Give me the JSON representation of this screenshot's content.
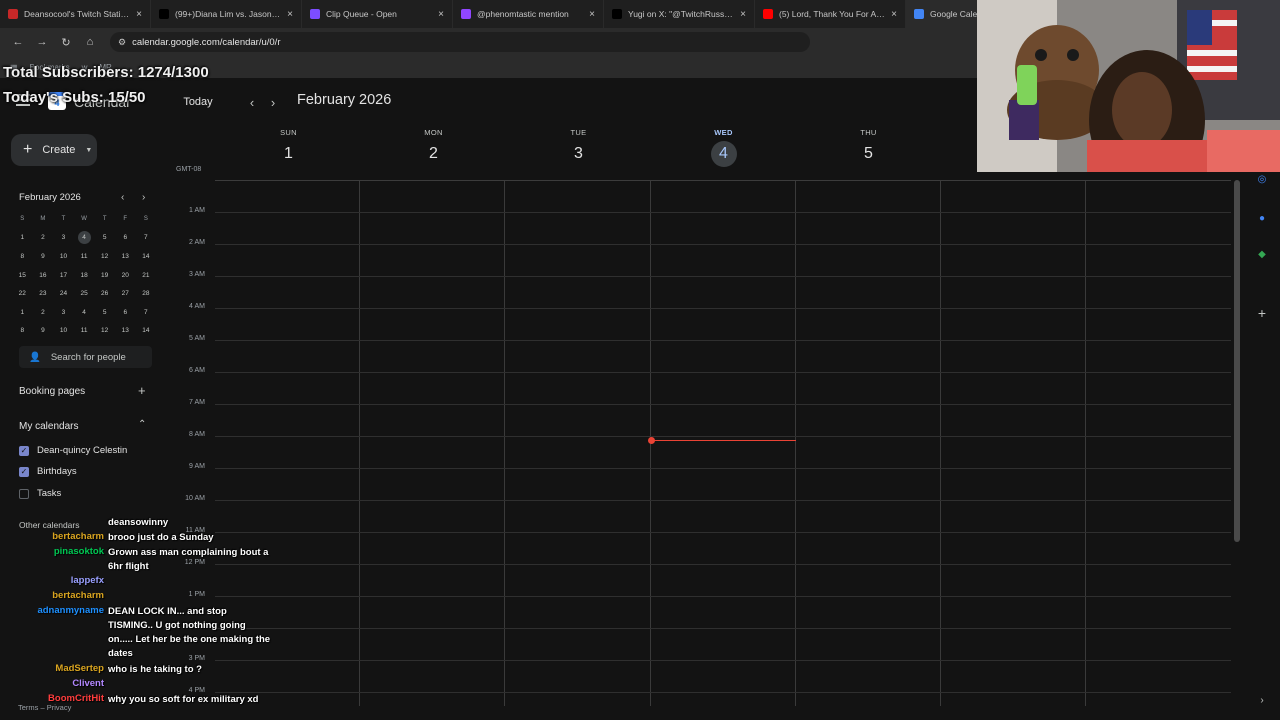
{
  "browser": {
    "tabs": [
      {
        "title": "Deansocool's Twitch Statistics",
        "fav": "chart",
        "color": "#c62828"
      },
      {
        "title": "(99+)Diana Lim vs. Jason the",
        "fav": "tiktok",
        "color": "#000000"
      },
      {
        "title": "Clip Queue - Open",
        "fav": "queue",
        "color": "#7c4dff"
      },
      {
        "title": "@phenomtastic mention",
        "fav": "twitch",
        "color": "#9146ff"
      },
      {
        "title": "Yugi on X: \"@TwitchRussel In",
        "fav": "x",
        "color": "#000000"
      },
      {
        "title": "(5) Lord, Thank You For All Yo",
        "fav": "youtube",
        "color": "#ff0000"
      },
      {
        "title": "Google Calendar",
        "fav": "calendar",
        "color": "#4285f4"
      }
    ],
    "url": "calendar.google.com/calendar/u/0/r",
    "bookmarks": [
      "Bookmarks",
      "w",
      "MR"
    ]
  },
  "overlay": {
    "total_subs": "Total Subscribers: 1274/1300",
    "today_subs": "Today's Subs: 15/50"
  },
  "calendar": {
    "app_name": "Calendar",
    "today_label": "Today",
    "month_title": "February 2026",
    "create_label": "Create",
    "timezone": "GMT-08",
    "days": [
      {
        "dow": "SUN",
        "num": "1"
      },
      {
        "dow": "MON",
        "num": "2"
      },
      {
        "dow": "TUE",
        "num": "3"
      },
      {
        "dow": "WED",
        "num": "4",
        "today": true
      },
      {
        "dow": "THU",
        "num": "5"
      }
    ],
    "hours": [
      "1 AM",
      "2 AM",
      "3 AM",
      "4 AM",
      "5 AM",
      "6 AM",
      "7 AM",
      "8 AM",
      "9 AM",
      "10 AM",
      "11 AM",
      "12 PM",
      "1 PM",
      "2 PM",
      "3 PM",
      "4 PM"
    ],
    "mini": {
      "title": "February 2026",
      "dow": [
        "S",
        "M",
        "T",
        "W",
        "T",
        "F",
        "S"
      ],
      "weeks": [
        [
          "1",
          "2",
          "3",
          "4",
          "5",
          "6",
          "7"
        ],
        [
          "8",
          "9",
          "10",
          "11",
          "12",
          "13",
          "14"
        ],
        [
          "15",
          "16",
          "17",
          "18",
          "19",
          "20",
          "21"
        ],
        [
          "22",
          "23",
          "24",
          "25",
          "26",
          "27",
          "28"
        ],
        [
          "1",
          "2",
          "3",
          "4",
          "5",
          "6",
          "7"
        ],
        [
          "8",
          "9",
          "10",
          "11",
          "12",
          "13",
          "14"
        ]
      ],
      "today": "4"
    },
    "search_people": "Search for people",
    "booking_pages": "Booking pages",
    "my_calendars": "My calendars",
    "calendars": [
      {
        "name": "Dean-quincy Celestin",
        "checked": true
      },
      {
        "name": "Birthdays",
        "checked": true
      },
      {
        "name": "Tasks",
        "checked": false
      }
    ],
    "other_calendars": "Other calendars",
    "terms": "Terms – Privacy"
  },
  "chat": [
    {
      "user": "",
      "msg": "deansowinny",
      "user_color": "#ffffff"
    },
    {
      "user": "bertacharm",
      "msg": "brooo just do a Sunday",
      "user_color": "#daa520"
    },
    {
      "user": "pinasoktok",
      "msg": "Grown ass man complaining bout a 6hr flight",
      "user_color": "#00c853"
    },
    {
      "user": "lappefx",
      "msg": "",
      "user_color": "#9aa0ff"
    },
    {
      "user": "bertacharm",
      "msg": "",
      "user_color": "#daa520"
    },
    {
      "user": "adnanmyname",
      "msg": "DEAN LOCK IN... and stop TISMING.. U got nothing going on..... Let her be the one making the dates",
      "user_color": "#1e90ff"
    },
    {
      "user": "MadSertep",
      "msg": "who is he taking to ?",
      "user_color": "#daa520"
    },
    {
      "user": "Clivent",
      "msg": "",
      "user_color": "#b388ff"
    },
    {
      "user": "BoomCritHit",
      "msg": "why you so soft for ex military xd",
      "user_color": "#ff3d3d"
    }
  ]
}
